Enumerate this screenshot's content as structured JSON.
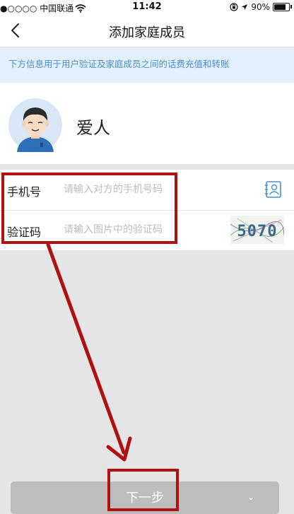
{
  "status_bar": {
    "carrier": "●○○○○ 中国联通",
    "time": "11:42",
    "battery": "90%",
    "battery_level": 0.9
  },
  "nav": {
    "title": "添加家庭成员",
    "back_icon": "chevron-left-icon"
  },
  "notice": "下方信息用于用户验证及家庭成员之间的话费充值和转账",
  "profile": {
    "name": "爱人",
    "avatar_icon": "avatar-man-icon"
  },
  "form": {
    "phone": {
      "label": "手机号",
      "placeholder": "请输入对方的手机号码",
      "value": "",
      "icon": "contact-book-icon"
    },
    "captcha": {
      "label": "验证码",
      "placeholder": "请输入图片中的验证码",
      "value": "",
      "image_text": "5070"
    }
  },
  "next_button": {
    "label": "下一步",
    "hint": "⌄"
  },
  "colors": {
    "accent_blue": "#4a8fcf",
    "notice_bg": "#e3f0fb",
    "highlight_red": "#b01010",
    "disabled_button": "#bdbdbd"
  }
}
